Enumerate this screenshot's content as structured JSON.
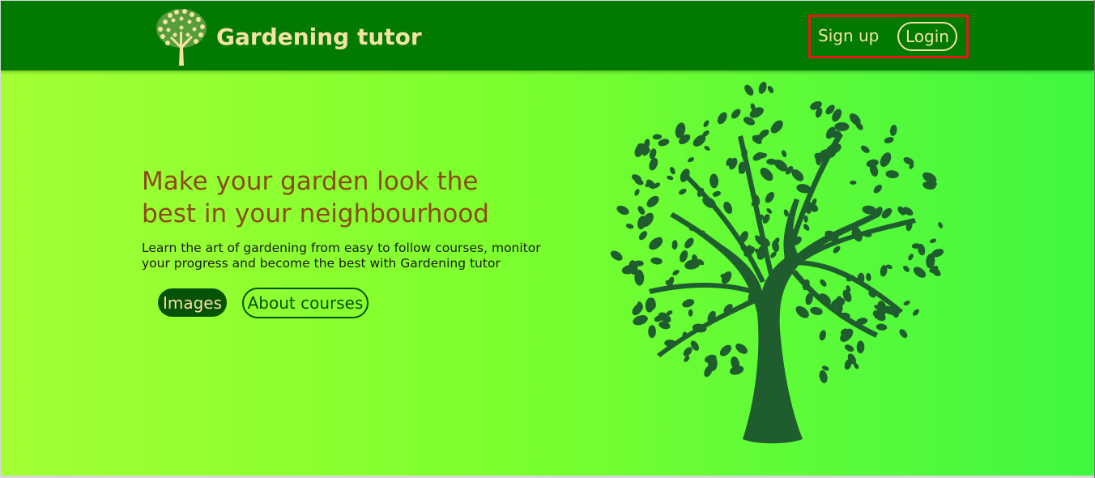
{
  "header": {
    "brand_name": "Gardening tutor",
    "signup_label": "Sign up",
    "login_label": "Login",
    "logo_icon": "tree-logo-icon"
  },
  "hero": {
    "headline_line1": "Make your garden look the",
    "headline_line2": "best in your neighbourhood",
    "subtext_line1": "Learn the art of gardening from easy to follow courses, monitor",
    "subtext_line2": "your progress and become the best with Gardening tutor",
    "images_button": "Images",
    "about_button": "About courses",
    "illustration_icon": "tree-illustration"
  },
  "colors": {
    "navbar": "#027a02",
    "accent_text": "#f2e3a4",
    "headline": "#8c4a12",
    "dark_green": "#065206",
    "tree": "#1f5c2e",
    "highlight_border": "#e8161a"
  }
}
